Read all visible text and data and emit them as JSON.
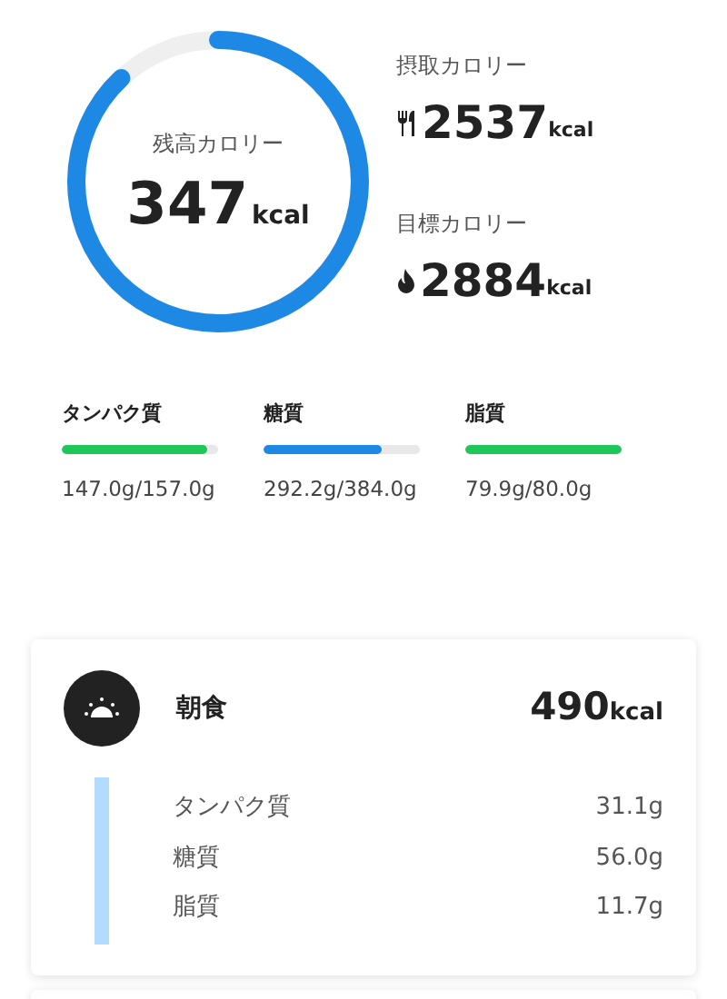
{
  "summary": {
    "remaining_label": "残高カロリー",
    "remaining_value": "347",
    "remaining_unit": "kcal",
    "intake_label": "摂取カロリー",
    "intake_value": "2537",
    "intake_unit": "kcal",
    "goal_label": "目標カロリー",
    "goal_value": "2884",
    "goal_unit": "kcal"
  },
  "macros": [
    {
      "name": "タンパク質",
      "level": 0.93,
      "color": "#1ec75a",
      "amount": "147.0g/157.0g"
    },
    {
      "name": "糖質",
      "level": 0.76,
      "color": "#1e88e5",
      "amount": "292.2g/384.0g"
    },
    {
      "name": "脂質",
      "level": 1.0,
      "color": "#1ec75a",
      "amount": "79.9g/80.0g"
    }
  ],
  "meal": {
    "name": "朝食",
    "value": "490",
    "unit": "kcal",
    "items": [
      {
        "name": "タンパク質",
        "amount": "31.1g"
      },
      {
        "name": "糖質",
        "amount": "56.0g"
      },
      {
        "name": "脂質",
        "amount": "11.7g"
      }
    ]
  }
}
